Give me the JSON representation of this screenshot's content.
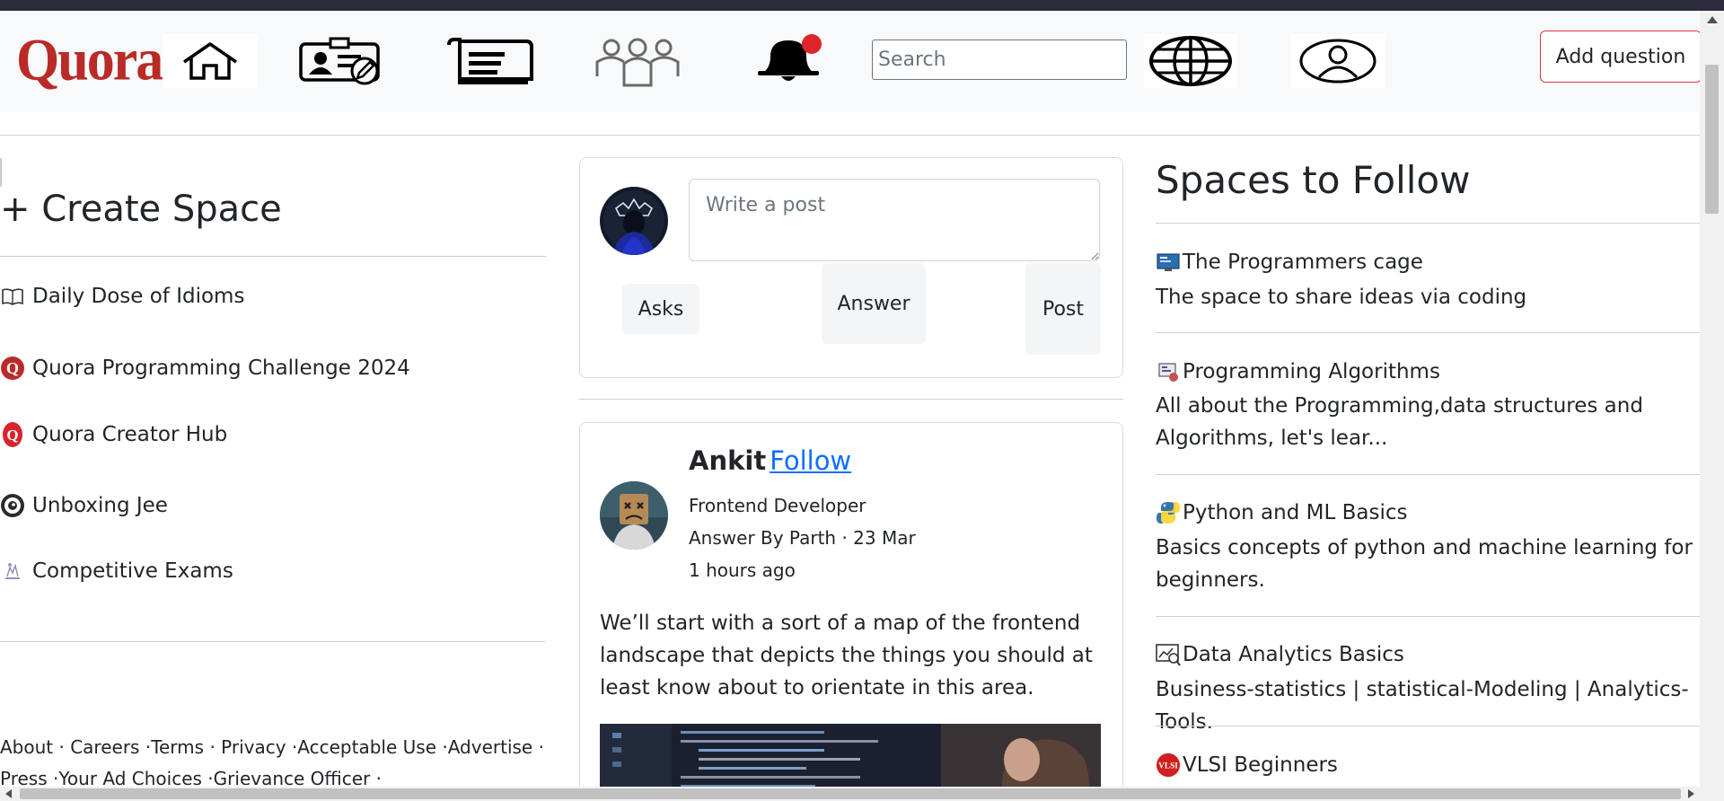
{
  "header": {
    "logo_text": "Quora",
    "search_placeholder": "Search",
    "add_question_label": "Add question",
    "nav_icons": [
      "home-icon",
      "profile-edit-icon",
      "following-feed-icon",
      "spaces-group-icon",
      "notification-bell-icon",
      "globe-icon",
      "user-icon"
    ]
  },
  "sidebar": {
    "create_space_label": "+ Create Space",
    "items": [
      {
        "label": "Daily Dose of Idioms",
        "icon": "book-icon"
      },
      {
        "label": "Quora Programming Challenge 2024",
        "icon": "quora-q-icon"
      },
      {
        "label": "Quora Creator Hub",
        "icon": "quora-q-icon"
      },
      {
        "label": "Unboxing Jee",
        "icon": "eye-icon"
      },
      {
        "label": "Competitive Exams",
        "icon": "exam-icon"
      }
    ],
    "footer": {
      "line1": [
        "About · ",
        "Careers ·",
        "Terms · ",
        "Privacy ·",
        "Acceptable Use ·",
        "Advertise ·"
      ],
      "line2": [
        "Press ·",
        "Your Ad Choices ·",
        "Grievance Officer ·"
      ]
    }
  },
  "composer": {
    "placeholder": "Write a post",
    "asks_label": "Asks",
    "answer_label": "Answer",
    "post_label": "Post"
  },
  "post": {
    "author": "Ankit",
    "follow_label": "Follow",
    "role": "Frontend Developer",
    "answer_by": "Answer By Parth · 23 Mar",
    "time_ago": "1 hours ago",
    "body": "We’ll start with a sort of a map of the frontend landscape that depicts the things you should at least know about to orientate in this area."
  },
  "spaces": {
    "title": "Spaces to Follow",
    "items": [
      {
        "name": "The Programmers cage",
        "desc": "The space to share ideas via coding",
        "icon": "monitor-code-icon"
      },
      {
        "name": "Programming Algorithms",
        "desc": "All about the Programming,data structures and Algorithms, let's lear...",
        "icon": "algorithm-icon"
      },
      {
        "name": "Python and ML Basics",
        "desc": "Basics concepts of python and machine learning for beginners.",
        "icon": "python-icon"
      },
      {
        "name": "Data Analytics Basics",
        "desc": "Business-statistics | statistical-Modeling | Analytics-Tools.",
        "icon": "analytics-icon"
      },
      {
        "name": "VLSI Beginners",
        "desc": "",
        "icon": "vlsi-icon"
      }
    ],
    "vlsi_badge": "VLSI"
  },
  "colors": {
    "brand": "#b92b27",
    "link": "#0d6efd",
    "danger_border": "#dc3545",
    "navbar_bg": "#f8f9fa"
  }
}
